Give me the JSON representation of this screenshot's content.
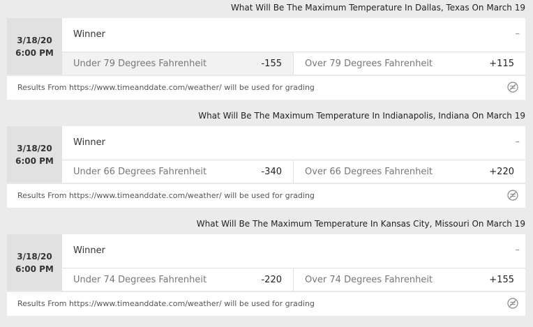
{
  "markets": [
    {
      "title": "What Will Be The Maximum Temperature In Dallas, Texas On March 19",
      "date": "3/18/20",
      "time": "6:00 PM",
      "winner_label": "Winner",
      "winner_value": "–",
      "under": {
        "label": "Under 79 Degrees Fahrenheit",
        "odds": "-155"
      },
      "over": {
        "label": "Over 79 Degrees Fahrenheit",
        "odds": "+115"
      },
      "footer": "Results From https://www.timeanddate.com/weather/ will be used for grading"
    },
    {
      "title": "What Will Be The Maximum Temperature In Indianapolis, Indiana On March 19",
      "date": "3/18/20",
      "time": "6:00 PM",
      "winner_label": "Winner",
      "winner_value": "–",
      "under": {
        "label": "Under 66 Degrees Fahrenheit",
        "odds": "-340"
      },
      "over": {
        "label": "Over 66 Degrees Fahrenheit",
        "odds": "+220"
      },
      "footer": "Results From https://www.timeanddate.com/weather/ will be used for grading"
    },
    {
      "title": "What Will Be The Maximum Temperature In Kansas City, Missouri On March 19",
      "date": "3/18/20",
      "time": "6:00 PM",
      "winner_label": "Winner",
      "winner_value": "–",
      "under": {
        "label": "Under 74 Degrees Fahrenheit",
        "odds": "-220"
      },
      "over": {
        "label": "Over 74 Degrees Fahrenheit",
        "odds": "+155"
      },
      "footer": "Results From https://www.timeanddate.com/weather/ will be used for grading"
    }
  ],
  "icons": {
    "footer_icon": "no-betting-stats-icon"
  },
  "colors": {
    "background": "#ebebeb",
    "date_panel": "#e1e1e1",
    "selected_option": "#f2f2f2"
  }
}
